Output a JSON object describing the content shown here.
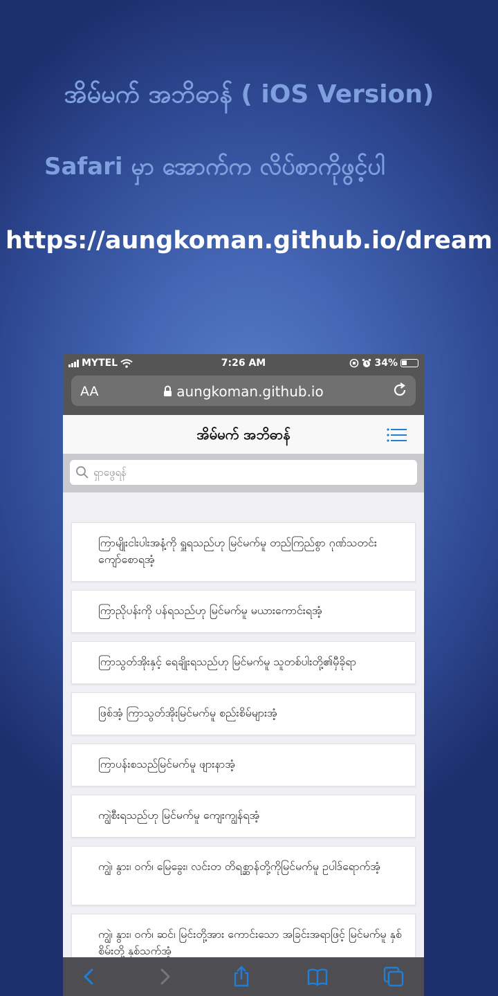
{
  "promo": {
    "title": "အိမ်မက် အဘိဓာန် ( iOS Version)",
    "subtitle": "Safari  မှာ  အောက်က လိပ်စာကိုဖွင့်ပါ",
    "url": "https://aungkoman.github.io/dream"
  },
  "status_bar": {
    "carrier": "MYTEL",
    "time": "7:26 AM",
    "battery": "34%",
    "battery_level": 0.34
  },
  "browser": {
    "text_size_label": "AA",
    "address": "aungkoman.github.io"
  },
  "app": {
    "title": "အိမ်မက် အဘိဓာန်",
    "search_placeholder": "ရှာဖွေရန်"
  },
  "entries": [
    {
      "text": "ကြာမျိုးငါးပါးအနံ့ကို ရှူရသည်ဟု မြင်မက်မူ တည်ကြည်စွာ ဂုဏ်သတင်းကျော်စောရအံ့"
    },
    {
      "text": "ကြာညိုပန်းကို ပန်ရသည်ဟု မြင်မက်မူ မယားကောင်းရအံ့"
    },
    {
      "text": "ကြာသွတ်အိုးနှင့် ရေချိုးရသည်ဟု မြင်မက်မူ သူတစ်ပါးတို့၏မှီခိုရာ"
    },
    {
      "text": "ဖြစ်အံ့ ကြာသွတ်အိုးမြင်မက်မူ စည်းစိမ်များအံ့"
    },
    {
      "text": "ကြာပန်းစသည်မြင်မက်မူ ဖျားနာအံ့"
    },
    {
      "text": "ကျွဲစီးရသည်ဟု မြင်မက်မူ ကျေးကျွန်ရအံ့"
    },
    {
      "text": "ကျွဲ၊ နွား၊ ဝက်၊ မြေခွေး၊ လင်းတ တိရစ္ဆာန်တို့ကိုမြင်မက်မူ ဥပါဒ်ရောက်အံ့"
    },
    {
      "text": "ကျွဲ၊ နွား၊ ဝက်၊ ဆင်၊ မြင်းတို့အား ကောင်းသော အခြင်းအရာဖြင့် မြင်မက်မူ နှစ်စိမ်းတို့ နှစ်သက်အံ့"
    }
  ],
  "colors": {
    "promo_text": "#7fa0de",
    "url_text": "#ffffff",
    "accent": "#1e7ed8"
  }
}
